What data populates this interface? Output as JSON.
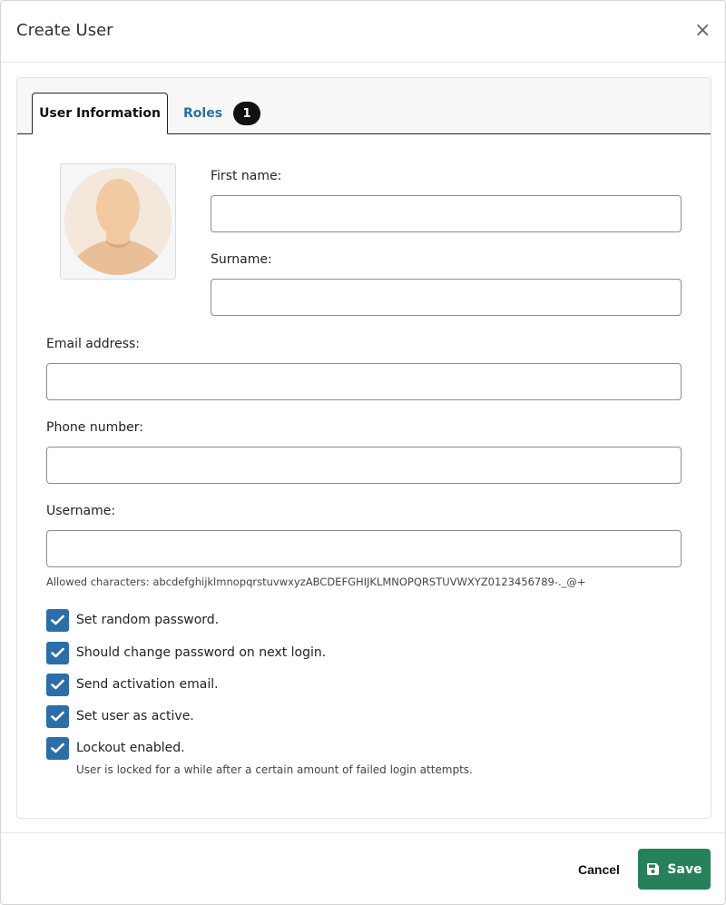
{
  "dialog": {
    "title": "Create User",
    "close_icon": "×"
  },
  "tabs": {
    "user_information": "User Information",
    "roles": "Roles",
    "roles_count": "1"
  },
  "avatar": {
    "icon": "user-avatar-icon"
  },
  "fields": {
    "first_name": {
      "label": "First name:",
      "value": ""
    },
    "surname": {
      "label": "Surname:",
      "value": ""
    },
    "email": {
      "label": "Email address:",
      "value": ""
    },
    "phone": {
      "label": "Phone number:",
      "value": ""
    },
    "username": {
      "label": "Username:",
      "value": ""
    }
  },
  "username_hint": "Allowed characters: abcdefghijklmnopqrstuvwxyzABCDEFGHIJKLMNOPQRSTUVWXYZ0123456789-._@+",
  "options": [
    {
      "label": "Set random password.",
      "checked": true
    },
    {
      "label": "Should change password on next login.",
      "checked": true
    },
    {
      "label": "Send activation email.",
      "checked": true
    },
    {
      "label": "Set user as active.",
      "checked": true
    },
    {
      "label": "Lockout enabled.",
      "checked": true
    }
  ],
  "lockout_hint": "User is locked for a while after a certain amount of failed login attempts.",
  "footer": {
    "cancel_label": "Cancel",
    "save_label": "Save",
    "save_icon": "floppy-disk-icon"
  },
  "colors": {
    "accent_blue": "#2b6ea8",
    "save_green": "#26805a"
  }
}
